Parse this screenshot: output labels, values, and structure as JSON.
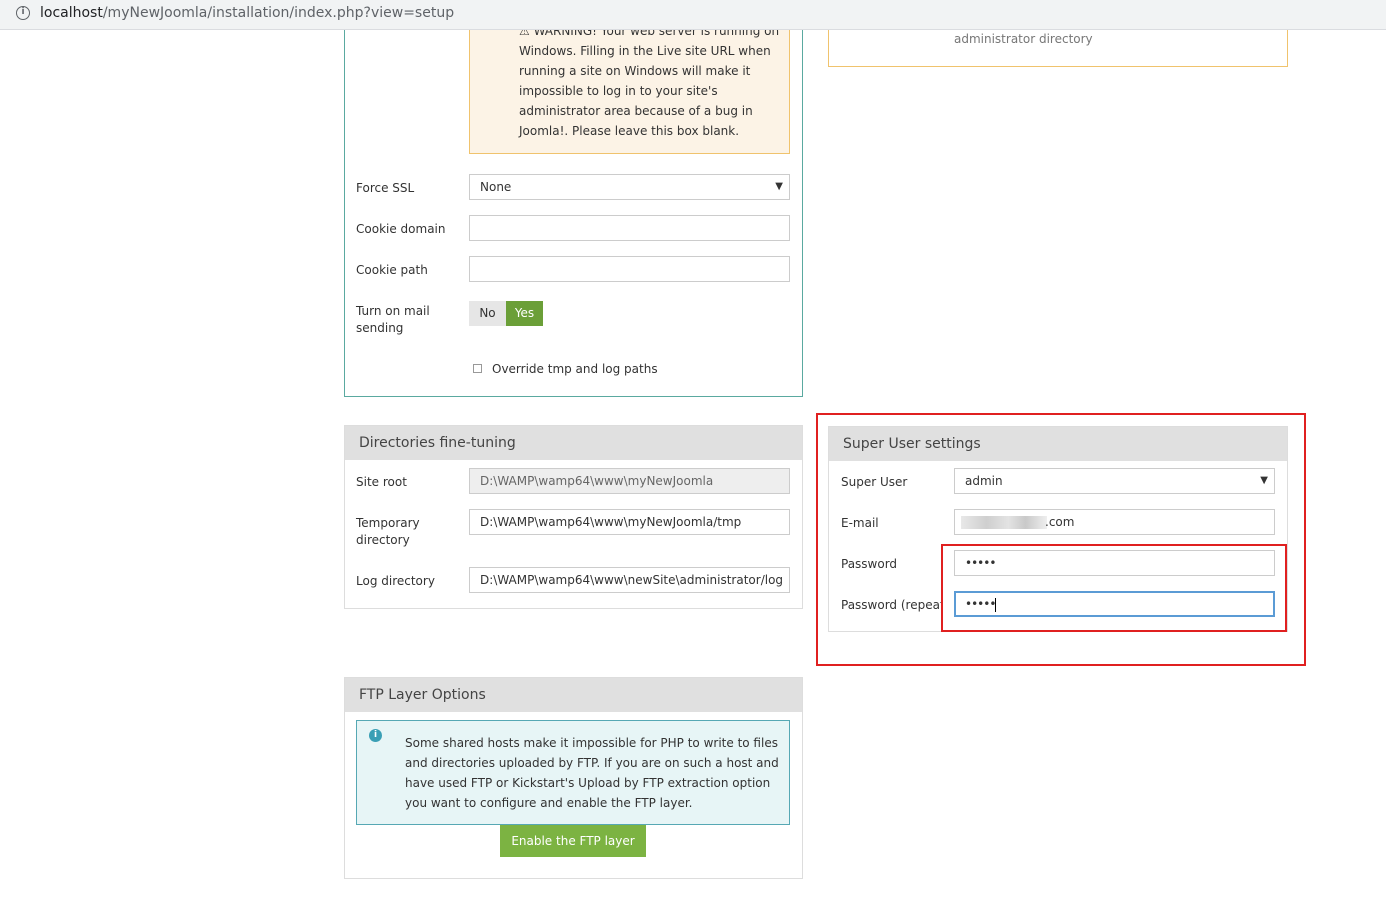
{
  "browser": {
    "url_host": "localhost",
    "url_path": "/myNewJoomla/installation/index.php?view=setup"
  },
  "site_panel": {
    "warning_lines": [
      "⚠ WARNING! Your web server is running on",
      "Windows. Filling in the Live site URL when",
      "running a site on Windows will make it",
      "impossible to log in to your site's",
      "administrator area because of a bug in",
      "Joomla!. Please leave this box blank."
    ],
    "force_ssl_label": "Force SSL",
    "force_ssl_value": "None",
    "cookie_domain_label": "Cookie domain",
    "cookie_domain_value": "",
    "cookie_path_label": "Cookie path",
    "cookie_path_value": "",
    "mail_label_line1": "Turn on mail",
    "mail_label_line2": "sending",
    "mail_no": "No",
    "mail_yes": "Yes",
    "override_label": "Override tmp and log paths"
  },
  "admin_panel_fragment": {
    "text": "administrator directory"
  },
  "directories": {
    "title": "Directories fine-tuning",
    "site_root_label": "Site root",
    "site_root_value": "D:\\WAMP\\wamp64\\www\\myNewJoomla",
    "temp_label_line1": "Temporary",
    "temp_label_line2": "directory",
    "temp_value": "D:\\WAMP\\wamp64\\www\\myNewJoomla/tmp",
    "log_label": "Log directory",
    "log_value": "D:\\WAMP\\wamp64\\www\\newSite\\administrator/log"
  },
  "super_user": {
    "title": "Super User settings",
    "user_label": "Super User",
    "user_value": "admin",
    "email_label": "E-mail",
    "email_value_suffix": ".com",
    "password_label": "Password",
    "password_value": "•••••",
    "password_repeat_label": "Password (repeat)",
    "password_repeat_value": "•••••"
  },
  "ftp": {
    "title": "FTP Layer Options",
    "info_lines": [
      "Some shared hosts make it impossible for PHP to write to files",
      "and directories uploaded by FTP. If you are on such a host and",
      "have used FTP or Kickstart's Upload by FTP extraction option",
      "you want to configure and enable the FTP layer."
    ],
    "button_label": "Enable the FTP layer"
  },
  "colors": {
    "accent_green": "#6b9f38",
    "button_green": "#7cb342",
    "highlight_red": "#e02020",
    "info_blue": "#3a9fb5"
  }
}
